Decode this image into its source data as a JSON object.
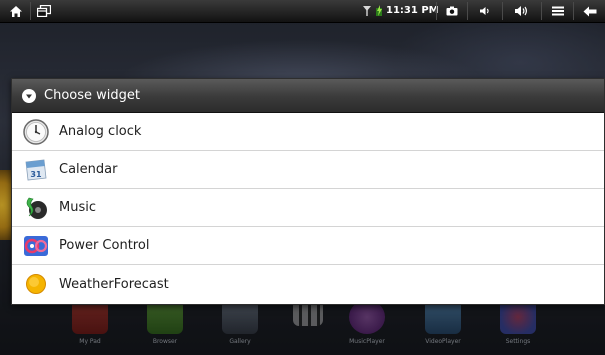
{
  "status_bar": {
    "time": "11:31 PM"
  },
  "dialog": {
    "title": "Choose widget",
    "items": [
      {
        "label": "Analog clock",
        "icon": "analog-clock-icon"
      },
      {
        "label": "Calendar",
        "icon": "calendar-icon"
      },
      {
        "label": "Music",
        "icon": "music-icon"
      },
      {
        "label": "Power Control",
        "icon": "power-control-icon"
      },
      {
        "label": "WeatherForecast",
        "icon": "weather-icon"
      }
    ],
    "calendar_day": "31"
  },
  "dock": {
    "items": [
      {
        "label": "My Pad"
      },
      {
        "label": "Browser"
      },
      {
        "label": "Gallery"
      },
      {
        "label": ""
      },
      {
        "label": "MusicPlayer"
      },
      {
        "label": "VideoPlayer"
      },
      {
        "label": "Settings"
      }
    ]
  },
  "colors": {
    "header_bg": "#3a3a3a",
    "list_bg": "#ffffff",
    "divider": "#d4d4d4",
    "weather_icon": "#f5b400"
  }
}
